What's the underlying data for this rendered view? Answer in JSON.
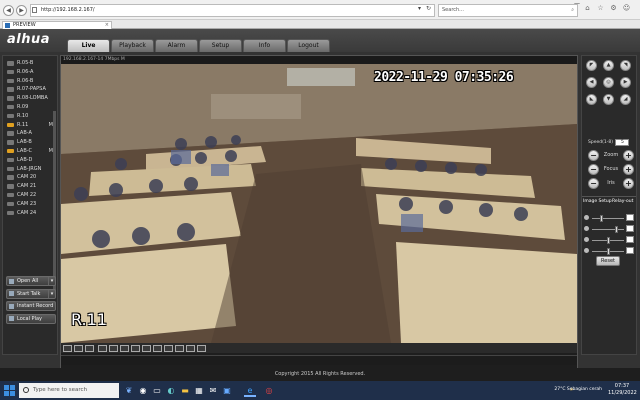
{
  "browser": {
    "back": "◀",
    "forward": "▶",
    "url": "http://192.168.2.167/",
    "search_placeholder": "Search...",
    "tab_title": "PREVIEW",
    "tab_close": "×",
    "min": "—",
    "max": "□",
    "close": "✕",
    "search_icon_glyph": "⌕",
    "home_glyph": "⌂",
    "star_glyph": "☆",
    "gear_glyph": "⚙",
    "smile_glyph": "☺",
    "refresh_glyph": "↻",
    "dropdown_glyph": "▾"
  },
  "app": {
    "logo": "alhua",
    "menu": [
      "Live",
      "Playback",
      "Alarm",
      "Setup",
      "Info",
      "Logout"
    ],
    "active_menu": "Live",
    "channels": [
      {
        "label": "R.05-B",
        "on": false,
        "m": ""
      },
      {
        "label": "R.06-A",
        "on": false,
        "m": ""
      },
      {
        "label": "R.06-B",
        "on": false,
        "m": ""
      },
      {
        "label": "R.07-PAPSA",
        "on": false,
        "m": ""
      },
      {
        "label": "R.08-LOMBA",
        "on": false,
        "m": ""
      },
      {
        "label": "R.09",
        "on": false,
        "m": ""
      },
      {
        "label": "R.10",
        "on": false,
        "m": ""
      },
      {
        "label": "R.11",
        "on": true,
        "m": "M"
      },
      {
        "label": "LAB-A",
        "on": false,
        "m": ""
      },
      {
        "label": "LAB-B",
        "on": false,
        "m": ""
      },
      {
        "label": "LAB-C",
        "on": true,
        "m": "M"
      },
      {
        "label": "LAB-D",
        "on": false,
        "m": ""
      },
      {
        "label": "LAB-JRGN",
        "on": false,
        "m": ""
      },
      {
        "label": "CAM 20",
        "on": false,
        "m": ""
      },
      {
        "label": "CAM 21",
        "on": false,
        "m": ""
      },
      {
        "label": "CAM 22",
        "on": false,
        "m": ""
      },
      {
        "label": "CAM 23",
        "on": false,
        "m": ""
      },
      {
        "label": "CAM 24",
        "on": false,
        "m": ""
      }
    ],
    "left_buttons": {
      "open_all": "Open All",
      "start_talk": "Start Talk",
      "instant_record": "Instant Record",
      "local_play": "Local Play",
      "caret": "▾"
    },
    "video": {
      "info_bar": "192.168.2.167-14 7Mbps M",
      "timestamp": "2022-11-29  07:35:26",
      "camera_name": "R.11"
    },
    "ptz": {
      "speed_label": "Speed(1-8)",
      "speed_value": "5",
      "zoom": "Zoom",
      "focus": "Focus",
      "iris": "Iris",
      "minus": "−",
      "plus": "+",
      "arrows": {
        "up_left": "◤",
        "up": "▲",
        "up_right": "◥",
        "left": "◀",
        "center": "◎",
        "right": "▶",
        "down_left": "◣",
        "down": "▼",
        "down_right": "◢"
      }
    },
    "image_setup": {
      "tab1": "Image Setup",
      "tab2": "Relay-out",
      "levels": [
        0.25,
        0.75,
        0.5,
        0.5
      ],
      "reset": "Reset"
    },
    "footer": "Copyright 2015 All Rights Reserved."
  },
  "taskbar": {
    "search_placeholder": "Type here to search",
    "weather": "27°C  Sebagian cerah",
    "time": "07:37",
    "date": "11/29/2022",
    "apps": [
      "task-view",
      "widgets",
      "edge",
      "file-explorer",
      "store",
      "mail",
      "ie",
      "chrome"
    ]
  }
}
